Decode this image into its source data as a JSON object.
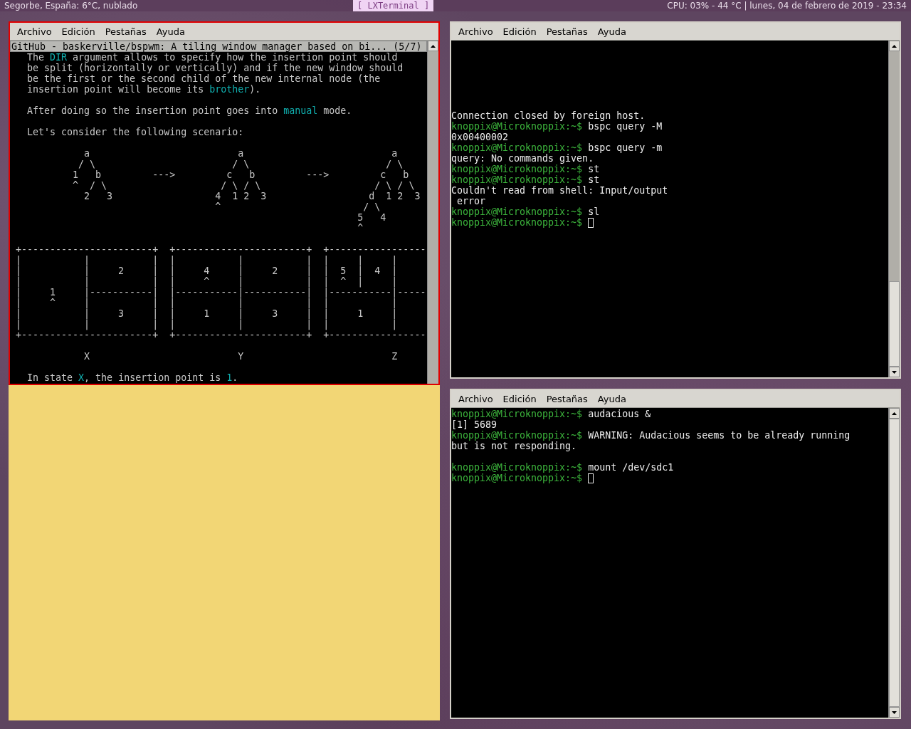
{
  "top_bar": {
    "weather": "Segorbe, España: 6°C, nublado",
    "active_window": "[ LXTerminal ]",
    "status": "CPU: 03% - 44 °C  |  lunes, 04 de febrero de 2019 - 23:34"
  },
  "terminals": [
    {
      "focused": true,
      "menu": [
        "Archivo",
        "Edición",
        "Pestañas",
        "Ayuda"
      ],
      "page_title": "GitHub - baskerville/bspwm: A tiling window manager based on bi... (5/7)",
      "lines": [
        {
          "kind": "text",
          "segments": [
            {
              "kind": "plain",
              "text": "   The "
            },
            {
              "kind": "link",
              "text": "DIR"
            },
            {
              "kind": "plain",
              "text": " argument allows to specify how the insertion point should"
            }
          ]
        },
        {
          "kind": "text",
          "segments": [
            {
              "kind": "plain",
              "text": "   be split (horizontally or vertically) and if the new window should"
            }
          ]
        },
        {
          "kind": "text",
          "segments": [
            {
              "kind": "plain",
              "text": "   be the first or the second child of the new internal node (the"
            }
          ]
        },
        {
          "kind": "text",
          "segments": [
            {
              "kind": "plain",
              "text": "   insertion point will become its "
            },
            {
              "kind": "link",
              "text": "brother"
            },
            {
              "kind": "plain",
              "text": ")."
            }
          ]
        },
        {
          "kind": "blank"
        },
        {
          "kind": "text",
          "segments": [
            {
              "kind": "plain",
              "text": "   After doing so the insertion point goes into "
            },
            {
              "kind": "link",
              "text": "manual"
            },
            {
              "kind": "plain",
              "text": " mode."
            }
          ]
        },
        {
          "kind": "blank"
        },
        {
          "kind": "text",
          "segments": [
            {
              "kind": "plain",
              "text": "   Let's consider the following scenario:"
            }
          ]
        },
        {
          "kind": "blank"
        },
        {
          "kind": "text",
          "segments": [
            {
              "kind": "plain",
              "text": "             a                          a                          a"
            }
          ]
        },
        {
          "kind": "text",
          "segments": [
            {
              "kind": "plain",
              "text": "            / \\                        / \\                        / \\"
            }
          ]
        },
        {
          "kind": "text",
          "segments": [
            {
              "kind": "plain",
              "text": "           1   b         --->         c   b         --->         c   b"
            }
          ]
        },
        {
          "kind": "text",
          "segments": [
            {
              "kind": "plain",
              "text": "           ^  / \\                    / \\ / \\                    / \\ / \\"
            }
          ]
        },
        {
          "kind": "text",
          "segments": [
            {
              "kind": "plain",
              "text": "             2   3                  4  1 2  3                  d  1 2  3"
            }
          ]
        },
        {
          "kind": "text",
          "segments": [
            {
              "kind": "plain",
              "text": "                                    ^                         / \\"
            }
          ]
        },
        {
          "kind": "text",
          "segments": [
            {
              "kind": "plain",
              "text": "                                                             5   4"
            }
          ]
        },
        {
          "kind": "text",
          "segments": [
            {
              "kind": "plain",
              "text": "                                                             ^"
            }
          ]
        },
        {
          "kind": "blank"
        },
        {
          "kind": "text",
          "segments": [
            {
              "kind": "plain",
              "text": " +-----------------------+  +-----------------------+  +-----------------"
            }
          ]
        },
        {
          "kind": "text",
          "segments": [
            {
              "kind": "plain",
              "text": " |           |           |  |           |           |  |     |     |"
            }
          ]
        },
        {
          "kind": "text",
          "segments": [
            {
              "kind": "plain",
              "text": " |           |     2     |  |     4     |     2     |  |  5  |  4  |"
            }
          ]
        },
        {
          "kind": "text",
          "segments": [
            {
              "kind": "plain",
              "text": " |           |           |  |     ^     |           |  |  ^  |     |"
            }
          ]
        },
        {
          "kind": "text",
          "segments": [
            {
              "kind": "plain",
              "text": " |     1     |-----------|  |-----------|-----------|  |-----------|-----"
            }
          ]
        },
        {
          "kind": "text",
          "segments": [
            {
              "kind": "plain",
              "text": " |     ^     |           |  |           |           |  |           |"
            }
          ]
        },
        {
          "kind": "text",
          "segments": [
            {
              "kind": "plain",
              "text": " |           |     3     |  |     1     |     3     |  |     1     |"
            }
          ]
        },
        {
          "kind": "text",
          "segments": [
            {
              "kind": "plain",
              "text": " |           |           |  |           |           |  |           |"
            }
          ]
        },
        {
          "kind": "text",
          "segments": [
            {
              "kind": "plain",
              "text": " +-----------------------+  +-----------------------+  +-----------------"
            }
          ]
        },
        {
          "kind": "blank"
        },
        {
          "kind": "text",
          "segments": [
            {
              "kind": "plain",
              "text": "             X                          Y                          Z"
            }
          ]
        },
        {
          "kind": "blank"
        },
        {
          "kind": "text",
          "segments": [
            {
              "kind": "plain",
              "text": "   In state "
            },
            {
              "kind": "link",
              "text": "X"
            },
            {
              "kind": "plain",
              "text": ", the insertion point is "
            },
            {
              "kind": "link",
              "text": "1"
            },
            {
              "kind": "plain",
              "text": "."
            }
          ]
        }
      ]
    },
    {
      "focused": false,
      "menu": [
        "Archivo",
        "Edición",
        "Pestañas",
        "Ayuda"
      ],
      "lines": [
        {
          "kind": "blank"
        },
        {
          "kind": "blank"
        },
        {
          "kind": "blank"
        },
        {
          "kind": "blank"
        },
        {
          "kind": "blank"
        },
        {
          "kind": "blank"
        },
        {
          "kind": "text",
          "segments": [
            {
              "kind": "plain",
              "text": "Connection closed by foreign host."
            }
          ]
        },
        {
          "kind": "text",
          "segments": [
            {
              "kind": "prompt",
              "text": "knoppix@Microknoppix:~$"
            },
            {
              "kind": "plain",
              "text": " bspc query -M"
            }
          ]
        },
        {
          "kind": "text",
          "segments": [
            {
              "kind": "plain",
              "text": "0x00400002"
            }
          ]
        },
        {
          "kind": "text",
          "segments": [
            {
              "kind": "prompt",
              "text": "knoppix@Microknoppix:~$"
            },
            {
              "kind": "plain",
              "text": " bspc query -m"
            }
          ]
        },
        {
          "kind": "text",
          "segments": [
            {
              "kind": "plain",
              "text": "query: No commands given."
            }
          ]
        },
        {
          "kind": "text",
          "segments": [
            {
              "kind": "prompt",
              "text": "knoppix@Microknoppix:~$"
            },
            {
              "kind": "plain",
              "text": " st"
            }
          ]
        },
        {
          "kind": "text",
          "segments": [
            {
              "kind": "prompt",
              "text": "knoppix@Microknoppix:~$"
            },
            {
              "kind": "plain",
              "text": " st"
            }
          ]
        },
        {
          "kind": "text",
          "segments": [
            {
              "kind": "plain",
              "text": "Couldn't read from shell: Input/output"
            }
          ]
        },
        {
          "kind": "text",
          "segments": [
            {
              "kind": "plain",
              "text": " error"
            }
          ]
        },
        {
          "kind": "text",
          "segments": [
            {
              "kind": "prompt",
              "text": "knoppix@Microknoppix:~$"
            },
            {
              "kind": "plain",
              "text": " sl"
            }
          ]
        },
        {
          "kind": "text",
          "cursor": true,
          "segments": [
            {
              "kind": "prompt",
              "text": "knoppix@Microknoppix:~$"
            }
          ]
        }
      ]
    },
    {
      "focused": false,
      "menu": [
        "Archivo",
        "Edición",
        "Pestañas",
        "Ayuda"
      ],
      "lines": [
        {
          "kind": "text",
          "segments": [
            {
              "kind": "prompt",
              "text": "knoppix@Microknoppix:~$"
            },
            {
              "kind": "plain",
              "text": " audacious &"
            }
          ]
        },
        {
          "kind": "text",
          "segments": [
            {
              "kind": "plain",
              "text": "[1] 5689"
            }
          ]
        },
        {
          "kind": "text",
          "segments": [
            {
              "kind": "prompt",
              "text": "knoppix@Microknoppix:~$"
            },
            {
              "kind": "plain",
              "text": " WARNING: Audacious seems to be already running"
            }
          ]
        },
        {
          "kind": "text",
          "segments": [
            {
              "kind": "plain",
              "text": "but is not responding."
            }
          ]
        },
        {
          "kind": "blank"
        },
        {
          "kind": "text",
          "segments": [
            {
              "kind": "prompt",
              "text": "knoppix@Microknoppix:~$"
            },
            {
              "kind": "plain",
              "text": " mount /dev/sdc1"
            }
          ]
        },
        {
          "kind": "text",
          "cursor": true,
          "segments": [
            {
              "kind": "prompt",
              "text": "knoppix@Microknoppix:~$"
            }
          ]
        }
      ]
    }
  ],
  "note": {
    "kind": "sticky-note"
  }
}
